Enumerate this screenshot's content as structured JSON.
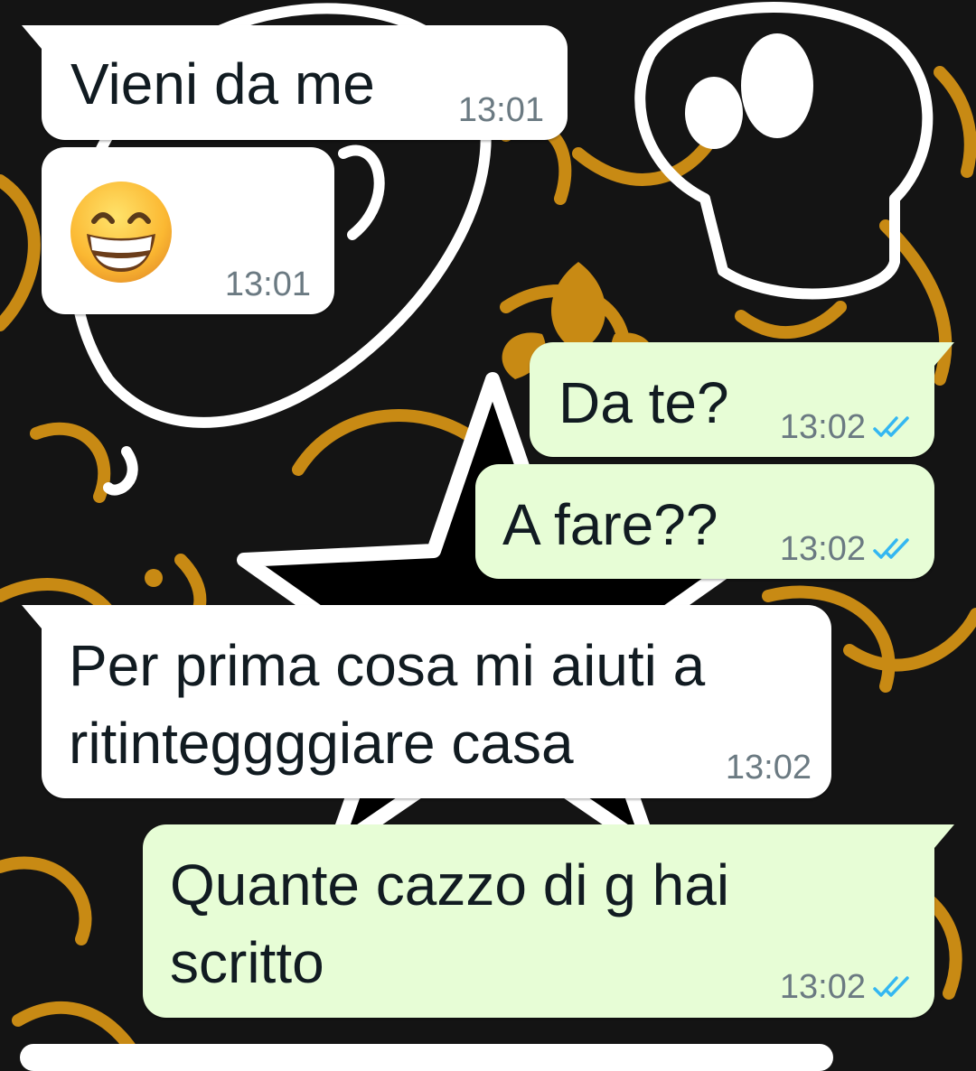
{
  "chat": {
    "messages": [
      {
        "direction": "incoming",
        "text": "Vieni da me",
        "time": "13:01"
      },
      {
        "direction": "incoming",
        "emoji_icon": "grinning-face-with-smiling-eyes-emoji",
        "time": "13:01"
      },
      {
        "direction": "outgoing",
        "text": "Da te?",
        "time": "13:02",
        "status_icon": "double-check-read-icon"
      },
      {
        "direction": "outgoing",
        "text": "A fare??",
        "time": "13:02",
        "status_icon": "double-check-read-icon"
      },
      {
        "direction": "incoming",
        "text_lines": [
          "Per prima cosa mi aiuti a",
          "ritinteggggiare casa"
        ],
        "time": "13:02"
      },
      {
        "direction": "outgoing",
        "text_lines": [
          "Quante cazzo di g hai",
          "scritto"
        ],
        "time": "13:02",
        "status_icon": "double-check-read-icon"
      }
    ]
  },
  "colors": {
    "incoming_bubble": "#ffffff",
    "outgoing_bubble": "#e7fdd6",
    "read_ticks": "#34b7f1",
    "wallpaper_bg": "#141414",
    "wallpaper_gold": "#c88a14"
  }
}
